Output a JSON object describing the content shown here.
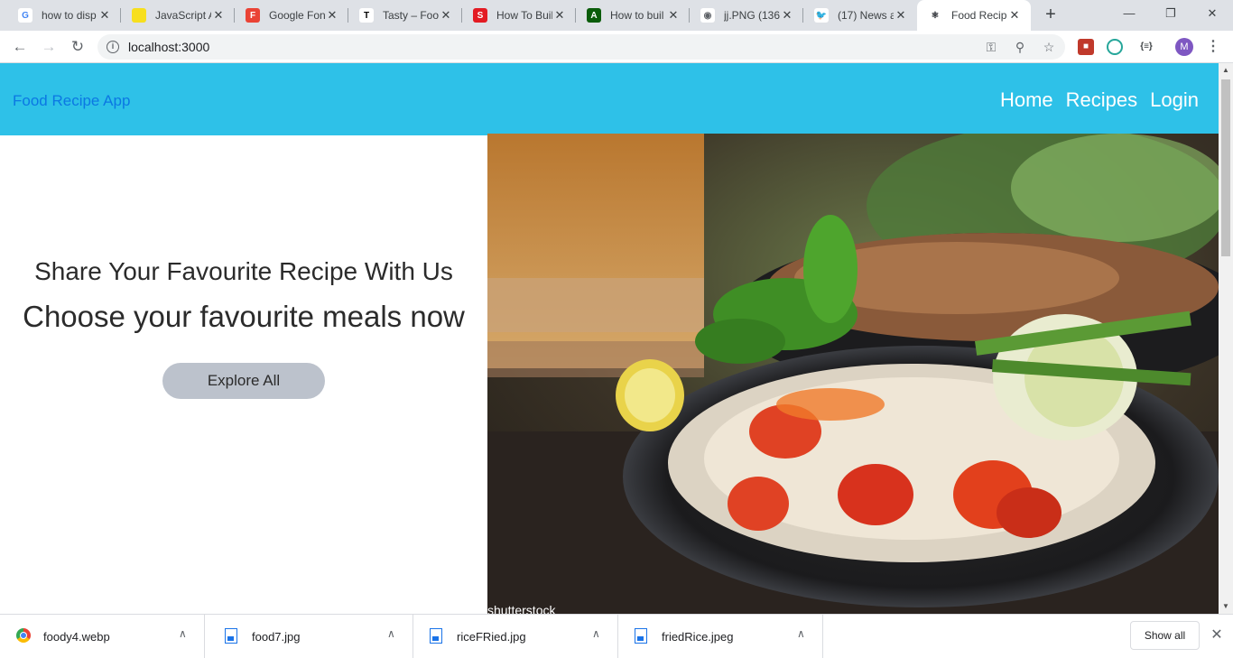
{
  "browser": {
    "tabs": [
      {
        "title": "how to disp",
        "icon": "google-icon",
        "fav_letter": "G",
        "fav_color": "#ffffff",
        "fav_text": "#4285f4"
      },
      {
        "title": "JavaScript A",
        "icon": "javascript-icon",
        "fav_letter": "",
        "fav_color": "#f7df1e",
        "fav_text": "#000000"
      },
      {
        "title": "Google Fon",
        "icon": "google-fonts-icon",
        "fav_letter": "F",
        "fav_color": "#ea4335",
        "fav_text": "#ffffff"
      },
      {
        "title": "Tasty – Foo",
        "icon": "tasty-icon",
        "fav_letter": "T",
        "fav_color": "#ffffff",
        "fav_text": "#000000"
      },
      {
        "title": "How To Buil",
        "icon": "scotch-icon",
        "fav_letter": "S",
        "fav_color": "#e31b23",
        "fav_text": "#ffffff"
      },
      {
        "title": "How to buil",
        "icon": "codepen-icon",
        "fav_letter": "A",
        "fav_color": "#0a5c0a",
        "fav_text": "#ffffff"
      },
      {
        "title": "jj.PNG (136",
        "icon": "globe-icon",
        "fav_letter": "◉",
        "fav_color": "#ffffff",
        "fav_text": "#5f6368"
      },
      {
        "title": "(17) News a",
        "icon": "twitter-icon",
        "fav_letter": "🐦",
        "fav_color": "#ffffff",
        "fav_text": "#1da1f2"
      },
      {
        "title": "Food Recip",
        "icon": "react-icon",
        "fav_letter": "⚛",
        "fav_color": "#ffffff",
        "fav_text": "#20232a"
      }
    ],
    "active_tab": 8,
    "new_tab_glyph": "+",
    "url": "localhost:3000",
    "avatar_letter": "M"
  },
  "page": {
    "brand": "Food Recipe App",
    "nav": [
      "Home",
      "Recipes",
      "Login"
    ],
    "hero": {
      "subtitle": "Share Your Favourite Recipe With Us",
      "title": "Choose your favourite meals now",
      "button": "Explore All",
      "watermark": "shutterstock"
    },
    "colors": {
      "navbar": "#2ec1e8",
      "brand": "#0b78e3",
      "button": "#bcc2cc"
    }
  },
  "downloads": {
    "items": [
      {
        "name": "foody4.webp",
        "icon": "chrome-icon"
      },
      {
        "name": "food7.jpg",
        "icon": "image-file-icon"
      },
      {
        "name": "riceFRied.jpg",
        "icon": "image-file-icon"
      },
      {
        "name": "friedRice.jpeg",
        "icon": "image-file-icon"
      }
    ],
    "show_all": "Show all"
  }
}
